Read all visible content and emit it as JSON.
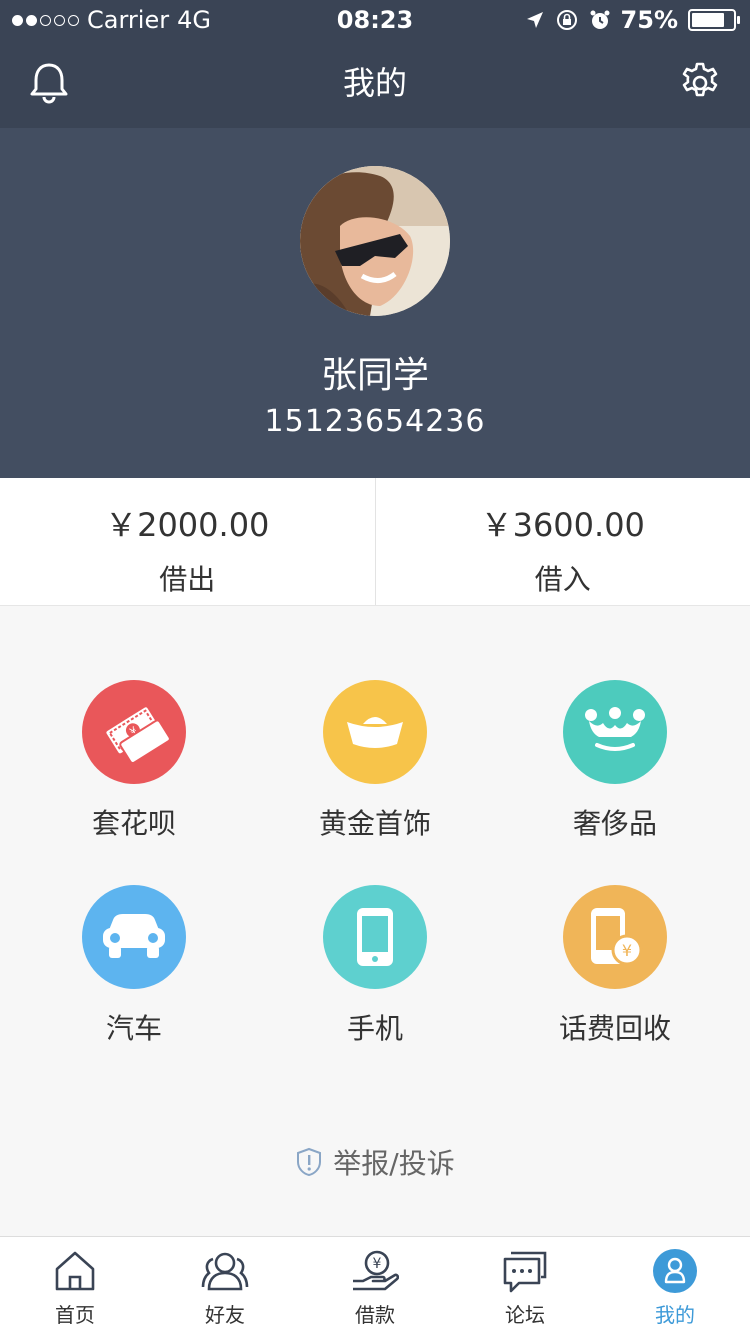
{
  "status_bar": {
    "carrier": "Carrier",
    "network": "4G",
    "time": "08:23",
    "battery": "75%",
    "signal_bars_filled": 2,
    "signal_bars_total": 5
  },
  "nav": {
    "title": "我的"
  },
  "profile": {
    "name": "张同学",
    "phone": "15123654236"
  },
  "balance": [
    {
      "amount": "￥2000.00",
      "label": "借出"
    },
    {
      "amount": "￥3600.00",
      "label": "借入"
    }
  ],
  "services": [
    {
      "label": "套花呗",
      "color": "#e9575a",
      "icon": "banknote-icon"
    },
    {
      "label": "黄金首饰",
      "color": "#f7c44a",
      "icon": "gold-ingot-icon"
    },
    {
      "label": "奢侈品",
      "color": "#4dcbbd",
      "icon": "crown-icon"
    },
    {
      "label": "汽车",
      "color": "#5db4ef",
      "icon": "car-icon"
    },
    {
      "label": "手机",
      "color": "#5ed0cf",
      "icon": "phone-icon"
    },
    {
      "label": "话费回收",
      "color": "#f0b558",
      "icon": "phone-yuan-icon"
    }
  ],
  "report": {
    "label": "举报/投诉"
  },
  "tabs": [
    {
      "label": "首页",
      "icon": "home-icon"
    },
    {
      "label": "好友",
      "icon": "friends-icon"
    },
    {
      "label": "借款",
      "icon": "loan-icon"
    },
    {
      "label": "论坛",
      "icon": "forum-icon"
    },
    {
      "label": "我的",
      "icon": "user-icon",
      "active": true
    }
  ],
  "colors": {
    "header_bg": "#3a4455",
    "profile_bg": "#434e61",
    "accent": "#3d9ad8"
  }
}
